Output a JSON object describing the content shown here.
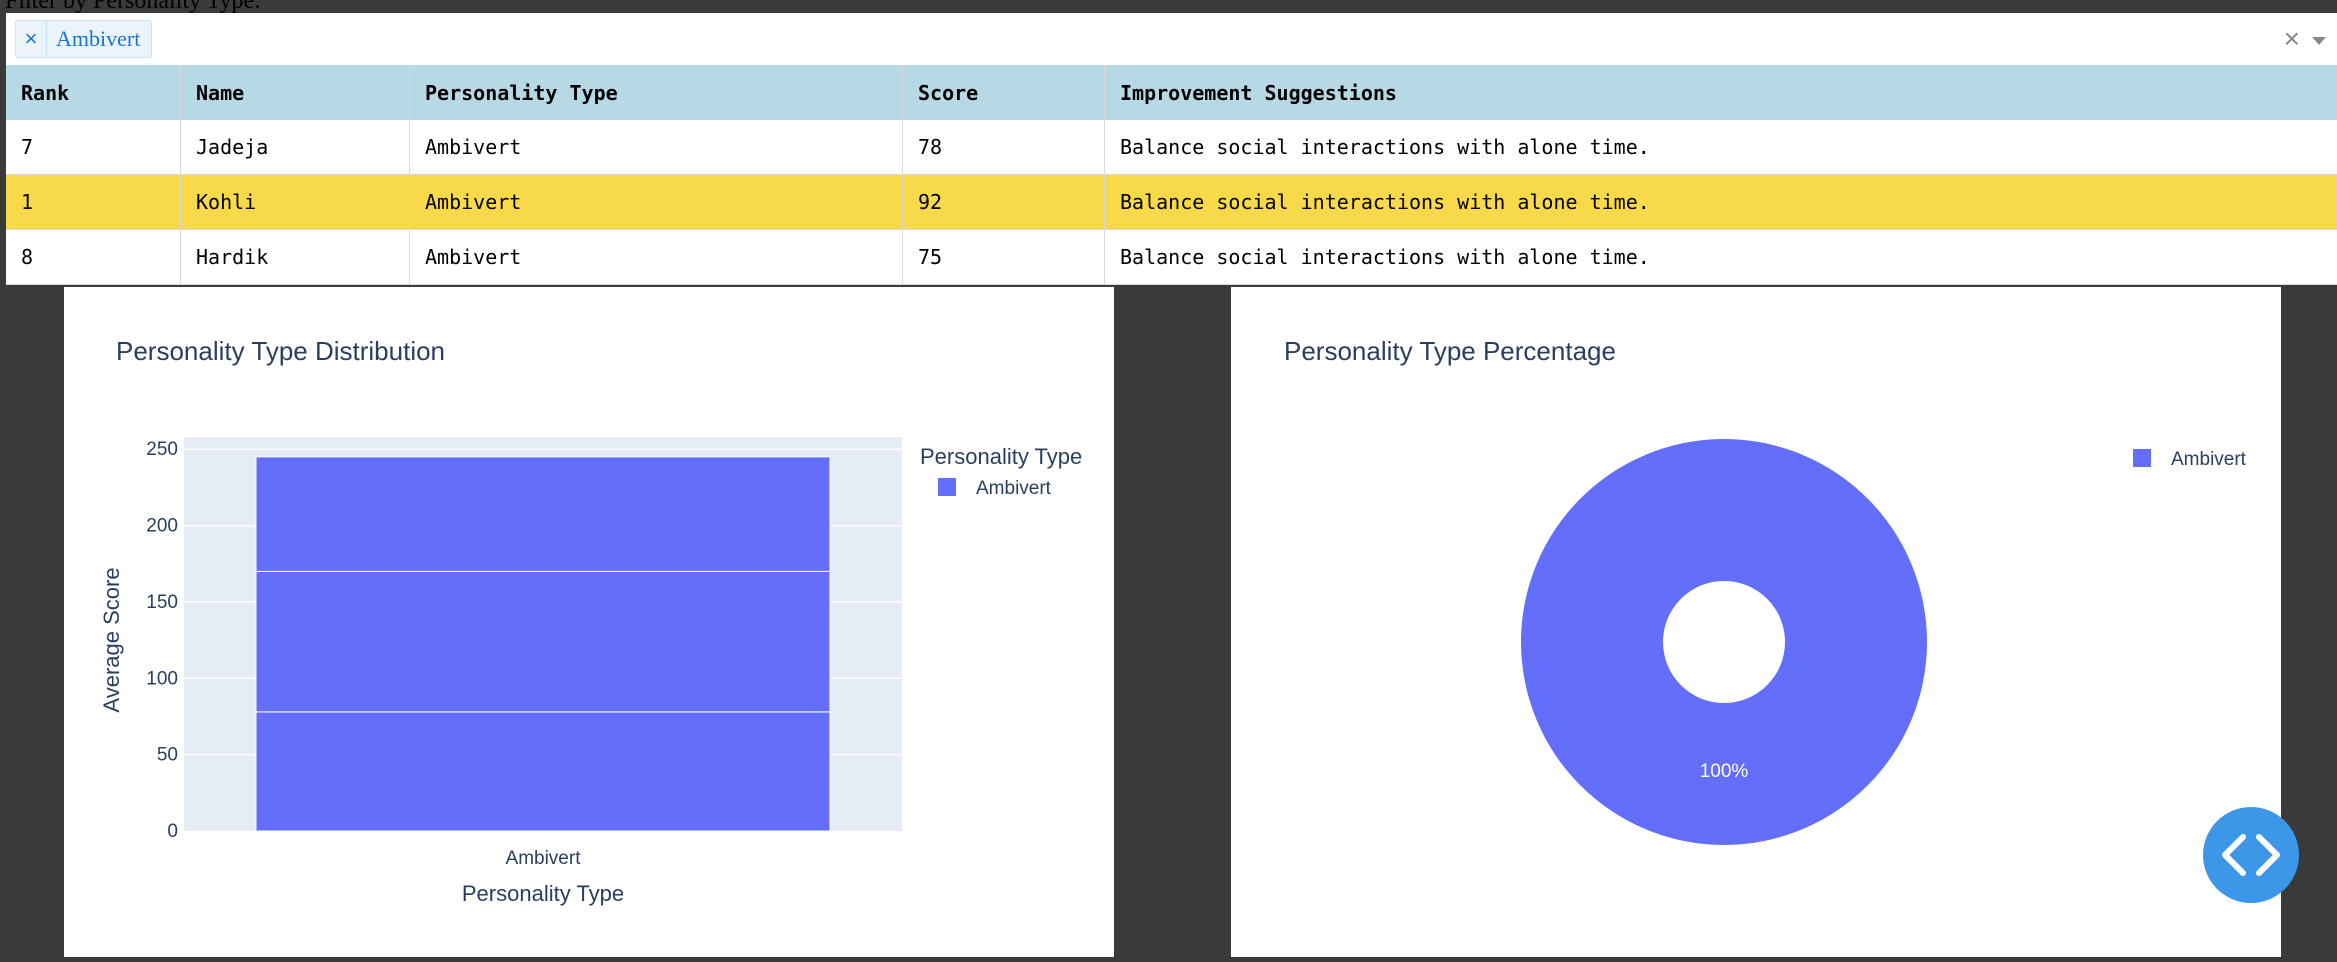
{
  "filter": {
    "label": "Filter by Personality Type:",
    "selected_chip": "Ambivert",
    "clear_glyph": "×",
    "chip_remove_glyph": "×"
  },
  "table": {
    "headers": [
      "Rank",
      "Name",
      "Personality Type",
      "Score",
      "Improvement Suggestions"
    ],
    "rows": [
      {
        "rank": "7",
        "name": "Jadeja",
        "type": "Ambivert",
        "score": "78",
        "suggestion": "Balance social interactions with alone time.",
        "highlighted": false
      },
      {
        "rank": "1",
        "name": "Kohli",
        "type": "Ambivert",
        "score": "92",
        "suggestion": "Balance social interactions with alone time.",
        "highlighted": true
      },
      {
        "rank": "8",
        "name": "Hardik",
        "type": "Ambivert",
        "score": "75",
        "suggestion": "Balance social interactions with alone time.",
        "highlighted": false
      }
    ],
    "highlight_color": "#f8d94a",
    "header_color": "#b7d9e5"
  },
  "chart_data": [
    {
      "type": "bar",
      "title": "Personality Type Distribution",
      "xlabel": "Personality Type",
      "ylabel": "Average Score",
      "categories": [
        "Ambivert"
      ],
      "stacked_segments": [
        78,
        92,
        75
      ],
      "ylim": [
        0,
        258
      ],
      "yticks": [
        0,
        50,
        100,
        150,
        200,
        250
      ],
      "legend_title": "Personality Type",
      "legend": [
        "Ambivert"
      ],
      "color": "#636efa",
      "grid": true
    },
    {
      "type": "pie",
      "title": "Personality Type Percentage",
      "labels": [
        "Ambivert"
      ],
      "values": [
        100
      ],
      "slice_label": "100%",
      "hole": true,
      "legend": [
        "Ambivert"
      ],
      "color": "#636efa"
    }
  ],
  "colors": {
    "accent": "#636efa",
    "page_bg": "#3a3a3a",
    "code_button": "#3d97e8"
  },
  "icons": {
    "code_button": "code-icon"
  }
}
